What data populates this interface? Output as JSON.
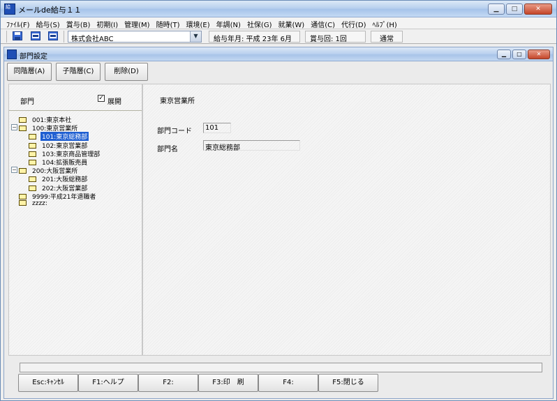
{
  "app": {
    "title": "メールde給与１１"
  },
  "menu": [
    "ﾌｧｲﾙ(F)",
    "給与(S)",
    "賞与(B)",
    "初期(I)",
    "管理(M)",
    "随時(T)",
    "環境(E)",
    "年調(N)",
    "社保(G)",
    "就業(W)",
    "通信(C)",
    "代行(D)",
    "ﾍﾙﾌﾟ(H)"
  ],
  "toolbar": {
    "company": "株式会社ABC",
    "pay_month": "給与年月: 平成 23年  6月",
    "bonus_count": "賞与回: 1回",
    "mode": "通常"
  },
  "child": {
    "title": "部門設定",
    "buttons": {
      "same_level": "同階層(A)",
      "child_level": "子階層(C)",
      "delete": "削除(D)"
    }
  },
  "tree_panel": {
    "header": "部門",
    "expand_label": "展開",
    "expand_checked": "✓",
    "nodes": [
      {
        "label": "001:東京本社",
        "level": 0,
        "expander": ""
      },
      {
        "label": "100:東京営業所",
        "level": 0,
        "expander": "−"
      },
      {
        "label": "101:東京総務部",
        "level": 1,
        "expander": "",
        "selected": true
      },
      {
        "label": "102:東京営業部",
        "level": 1,
        "expander": ""
      },
      {
        "label": "103:東京商品管理部",
        "level": 1,
        "expander": ""
      },
      {
        "label": "104:拡張販売員",
        "level": 1,
        "expander": ""
      },
      {
        "label": "200:大阪営業所",
        "level": 0,
        "expander": "−"
      },
      {
        "label": "201:大阪総務部",
        "level": 1,
        "expander": ""
      },
      {
        "label": "202:大阪営業部",
        "level": 1,
        "expander": ""
      },
      {
        "label": "9999:平成21年退職者",
        "level": 0,
        "expander": ""
      },
      {
        "label": "zzzz:",
        "level": 0,
        "expander": ""
      }
    ]
  },
  "detail": {
    "header": "東京営業所",
    "code_label": "部門コード",
    "code_value": "101",
    "name_label": "部門名",
    "name_value": "東京総務部"
  },
  "fkeys": [
    "Esc:ｷｬﾝｾﾙ",
    "F1:ヘルプ",
    "F2:",
    "F3:印　刷",
    "F4:",
    "F5:閉じる"
  ]
}
